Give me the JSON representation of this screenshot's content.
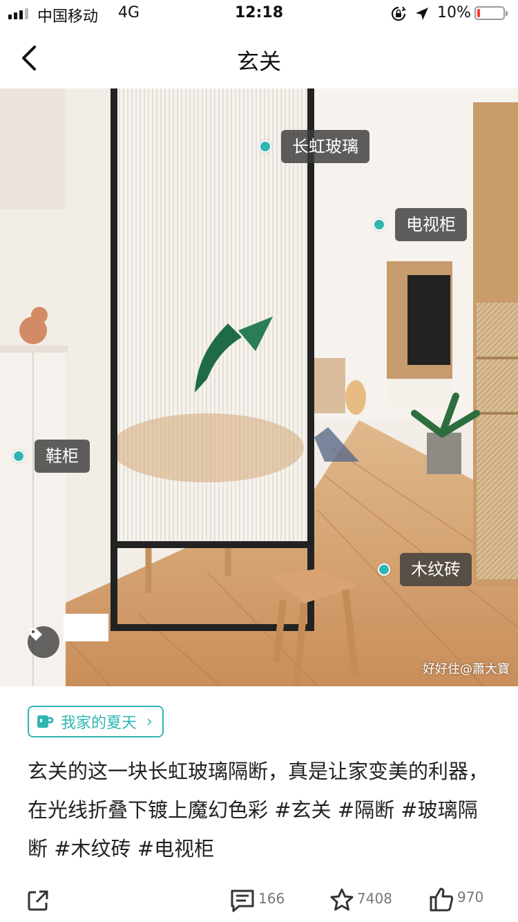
{
  "status_bar": {
    "carrier": "中国移动",
    "network": "4G",
    "time": "12:18",
    "battery": "10%",
    "battery_level": 0.1
  },
  "nav": {
    "back_icon": "chevron-left-icon",
    "title": "玄关"
  },
  "photo": {
    "hotspots": [
      {
        "label": "长虹玻璃"
      },
      {
        "label": "电视柜"
      },
      {
        "label": "鞋柜"
      },
      {
        "label": "木纹砖"
      }
    ],
    "tag_icon": "tag-icon",
    "watermark": "好好住@蕭大寶"
  },
  "topic": {
    "icon": "mug-icon",
    "label": "我家的夏天",
    "chevron": "›"
  },
  "description": {
    "text": "玄关的这一块长虹玻璃隔断，真是让家变美的利器，在光线折叠下镀上魔幻色彩",
    "hashtags": [
      "#玄关",
      "#隔断",
      "#玻璃隔断",
      "#木纹砖",
      "#电视柜"
    ]
  },
  "actions": {
    "share": {
      "icon": "share-icon"
    },
    "comments": {
      "icon": "comment-icon",
      "count": "166"
    },
    "favorites": {
      "icon": "star-icon",
      "count": "7408"
    },
    "likes": {
      "icon": "thumbs-up-icon",
      "count": "970"
    }
  },
  "colors": {
    "accent": "#31b5b3",
    "battery_low": "#ff3b30"
  }
}
